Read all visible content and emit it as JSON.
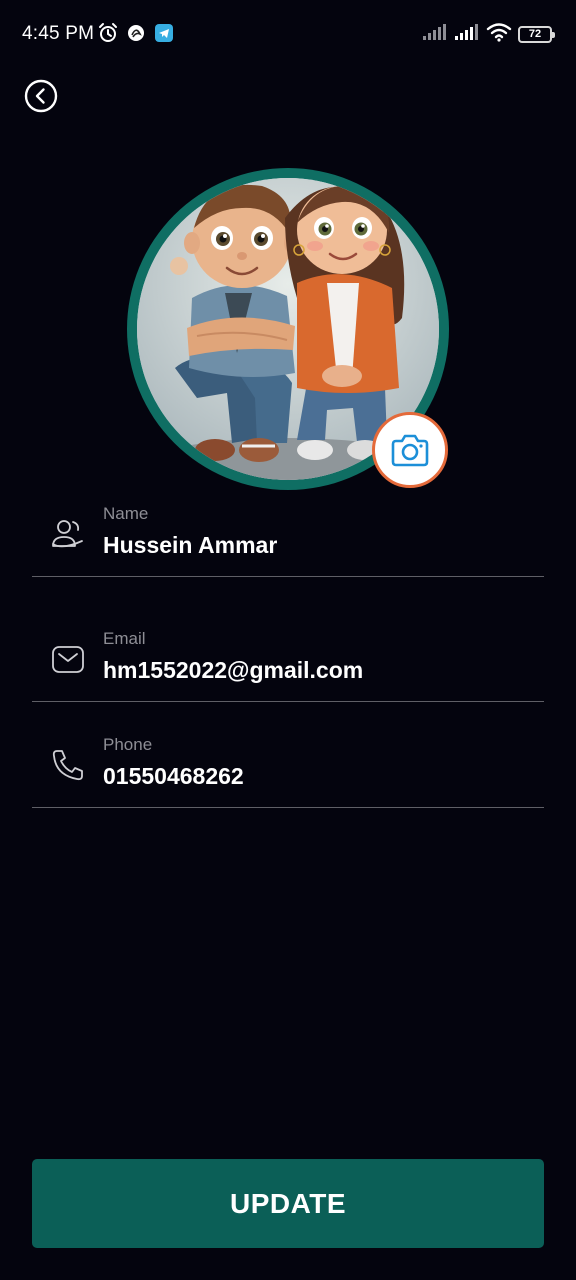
{
  "status_bar": {
    "time": "4:45 PM",
    "battery": "72",
    "left_icons": [
      "alarm-icon",
      "app-badge-icon",
      "telegram-icon"
    ],
    "right_icons": [
      "signal-icon",
      "signal-icon",
      "wifi-icon",
      "battery-icon"
    ]
  },
  "header": {
    "back_icon": "chevron-left-icon"
  },
  "profile": {
    "avatar": "cartoon-kids-avatar",
    "ring_color": "#0f6e63",
    "camera_icon": "camera-icon",
    "camera_border_color": "#e46a3a"
  },
  "fields": {
    "name": {
      "label": "Name",
      "value": "Hussein Ammar",
      "icon": "users-icon"
    },
    "email": {
      "label": "Email",
      "value": "hm1552022@gmail.com",
      "icon": "mail-icon"
    },
    "phone": {
      "label": "Phone",
      "value": "01550468262",
      "icon": "phone-icon"
    }
  },
  "actions": {
    "update_label": "UPDATE",
    "button_color": "#0b5f57"
  }
}
